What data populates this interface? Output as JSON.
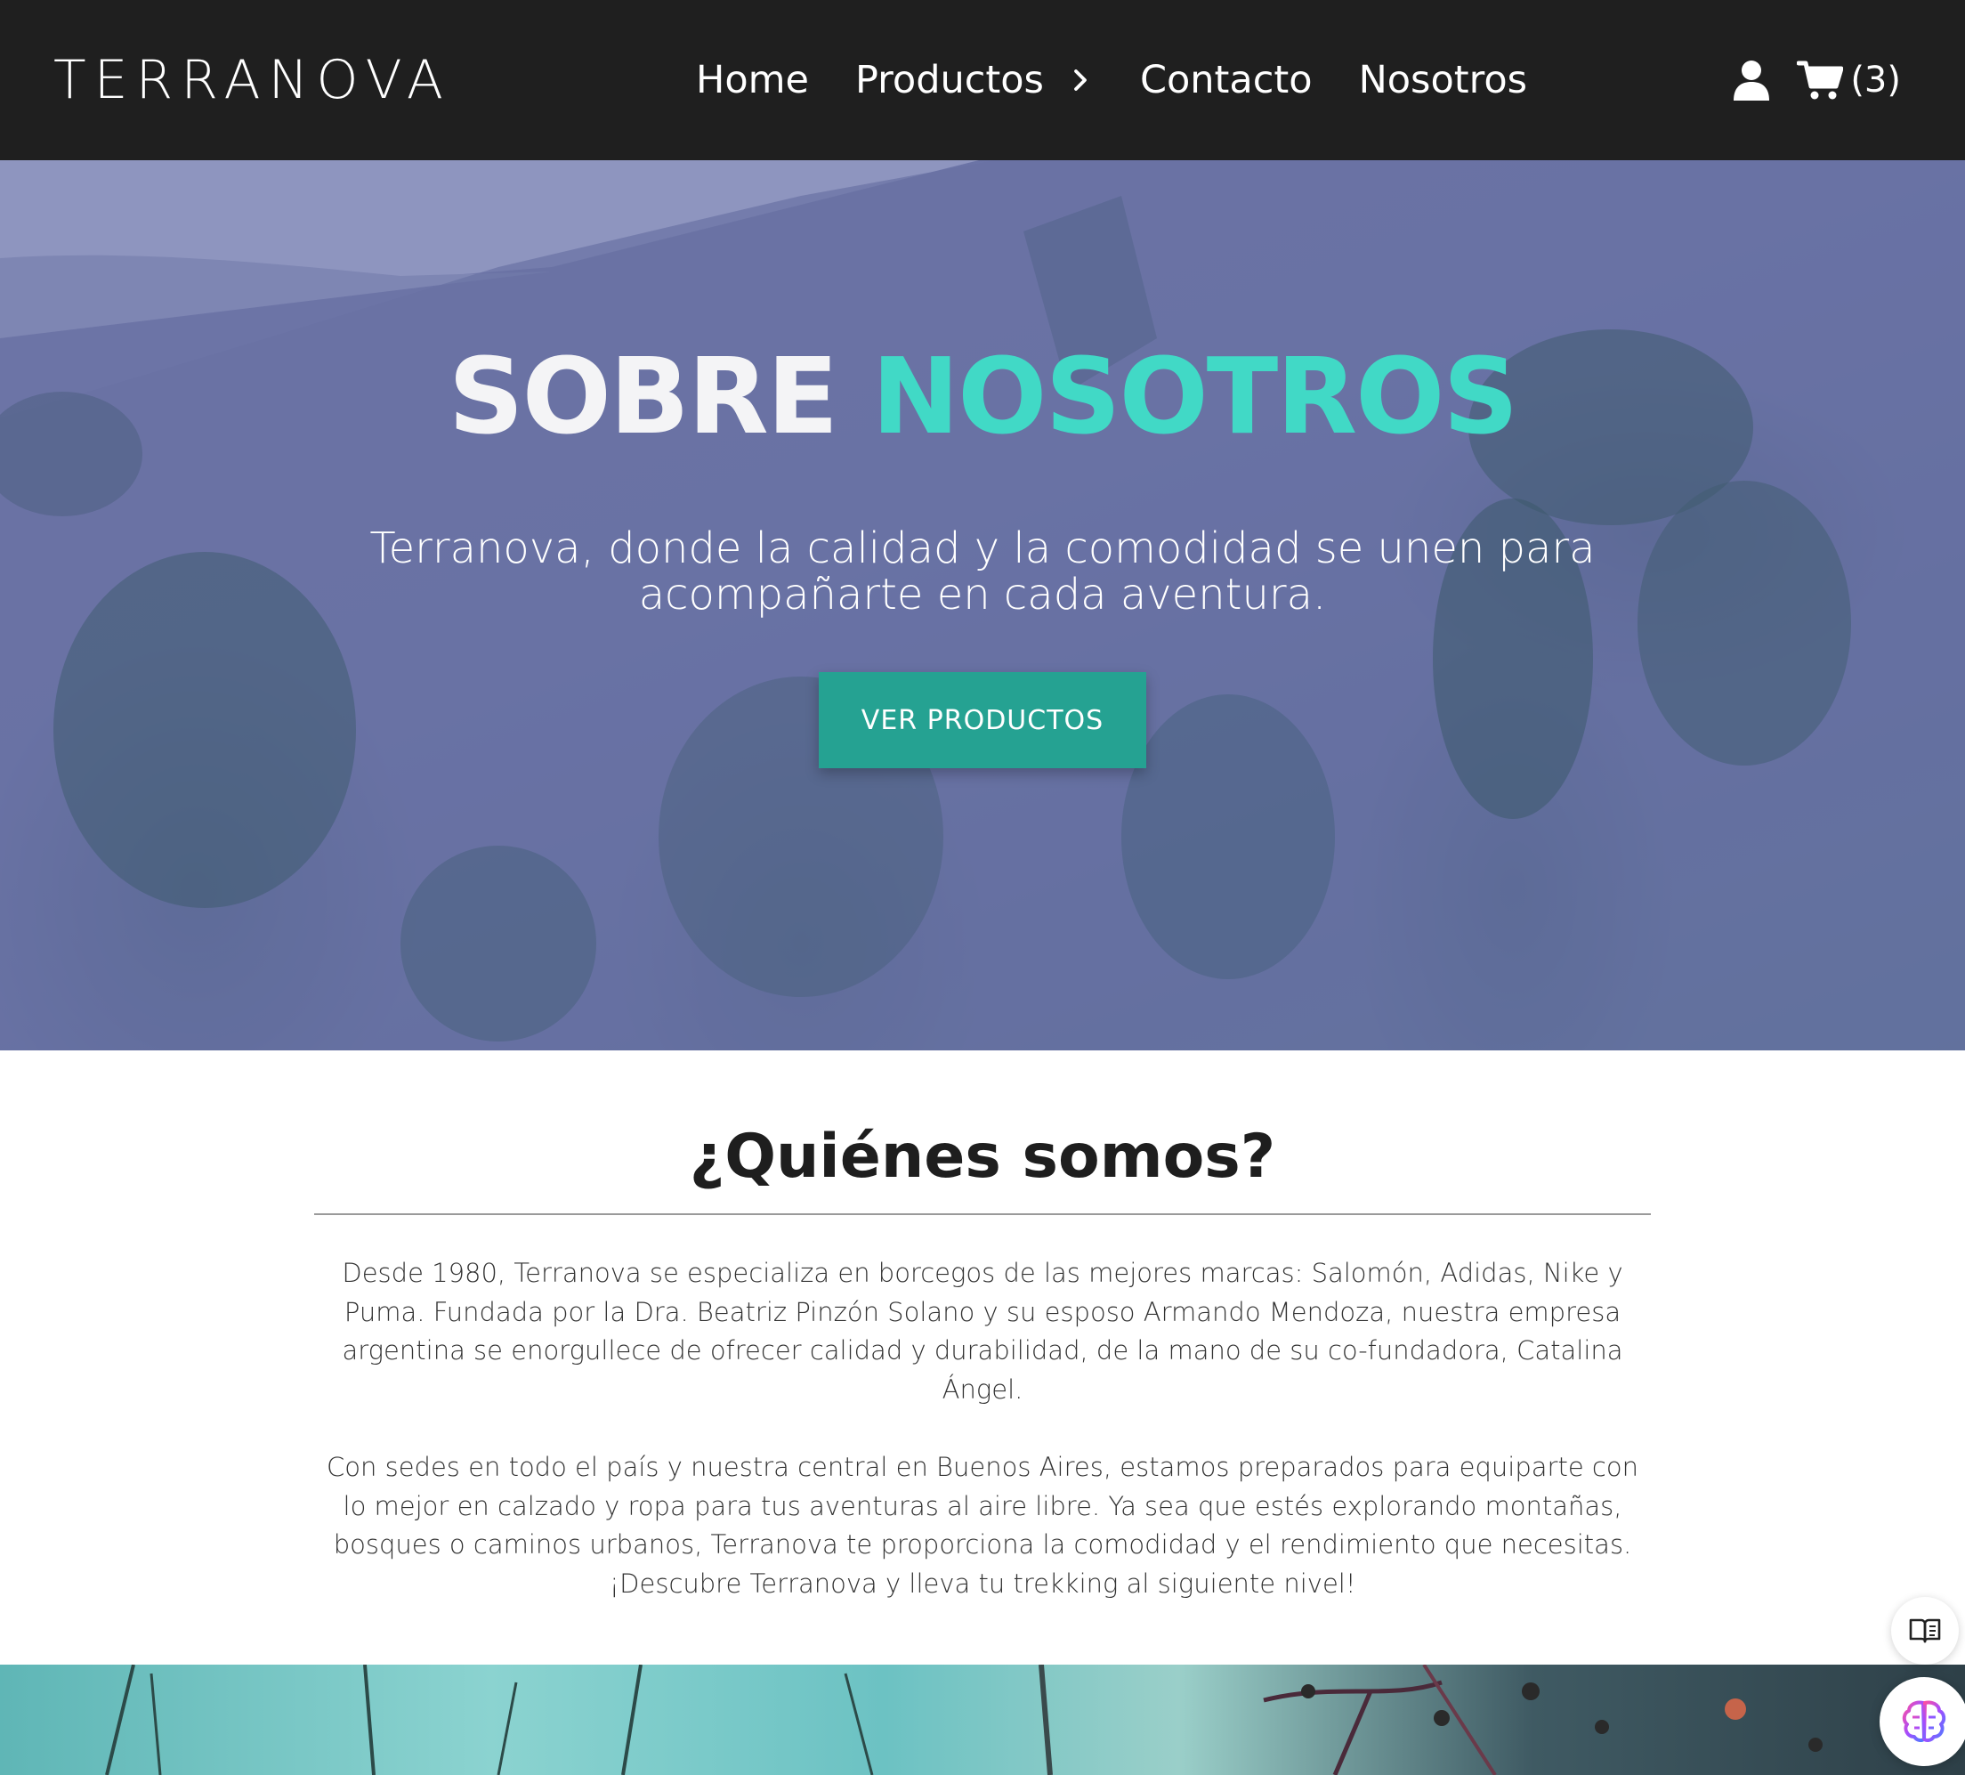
{
  "brand": {
    "logo_text": "TERRANOVA",
    "accent_color": "#41d9c6",
    "button_color": "#25a292",
    "nav_bg": "#1f1f1f"
  },
  "nav": {
    "items": [
      {
        "label": "Home"
      },
      {
        "label": "Productos",
        "icon": "chevron-right-icon"
      },
      {
        "label": "Contacto"
      },
      {
        "label": "Nosotros"
      }
    ],
    "user_icon": "user-icon",
    "cart_icon": "cart-icon",
    "cart_count": "(3)"
  },
  "hero": {
    "title_part1": "SOBRE",
    "title_part2": "NOSOTROS",
    "subtitle": "Terranova, donde la calidad y la comodidad se unen para acompañarte en cada aventura.",
    "cta_label": "VER PRODUCTOS"
  },
  "about": {
    "title": "¿Quiénes somos?",
    "paragraphs": [
      "Desde 1980, Terranova se especializa en borcegos de las mejores marcas: Salomón, Adidas, Nike y Puma. Fundada por la Dra. Beatriz Pinzón Solano y su esposo Armando Mendoza, nuestra empresa argentina se enorgullece de ofrecer calidad y durabilidad, de la mano de su co-fundadora, Catalina Ángel.",
      "Con sedes en todo el país y nuestra central en Buenos Aires, estamos preparados para equiparte con lo mejor en calzado y ropa para tus aventuras al aire libre. Ya sea que estés explorando montañas, bosques o caminos urbanos, Terranova te proporciona la comodidad y el rendimiento que necesitas. ¡Descubre Terranova y lleva tu trekking al siguiente nivel!"
    ]
  },
  "widgets": {
    "reader_icon": "book-reader-icon",
    "assistant_icon": "brain-icon"
  }
}
